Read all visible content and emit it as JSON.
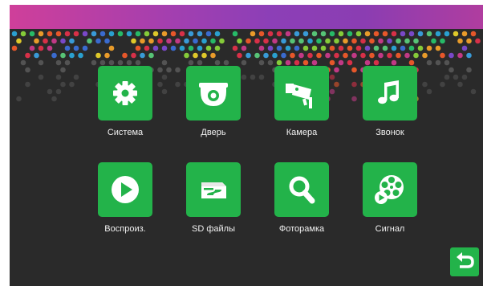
{
  "header": {
    "accent_color": "#8c3fb7"
  },
  "menu": {
    "tile_color": "#23b34a",
    "items": [
      {
        "label": "Система",
        "icon": "gear-icon"
      },
      {
        "label": "Дверь",
        "icon": "doorbell-camera-icon"
      },
      {
        "label": "Камера",
        "icon": "cctv-camera-icon"
      },
      {
        "label": "Звонок",
        "icon": "music-note-icon"
      },
      {
        "label": "Воспроиз.",
        "icon": "play-icon"
      },
      {
        "label": "SD файлы",
        "icon": "sd-card-icon"
      },
      {
        "label": "Фоторамка",
        "icon": "magnifier-icon"
      },
      {
        "label": "Сигнал",
        "icon": "film-reel-icon"
      }
    ]
  },
  "footer": {
    "back_icon": "back-arrow-icon"
  }
}
